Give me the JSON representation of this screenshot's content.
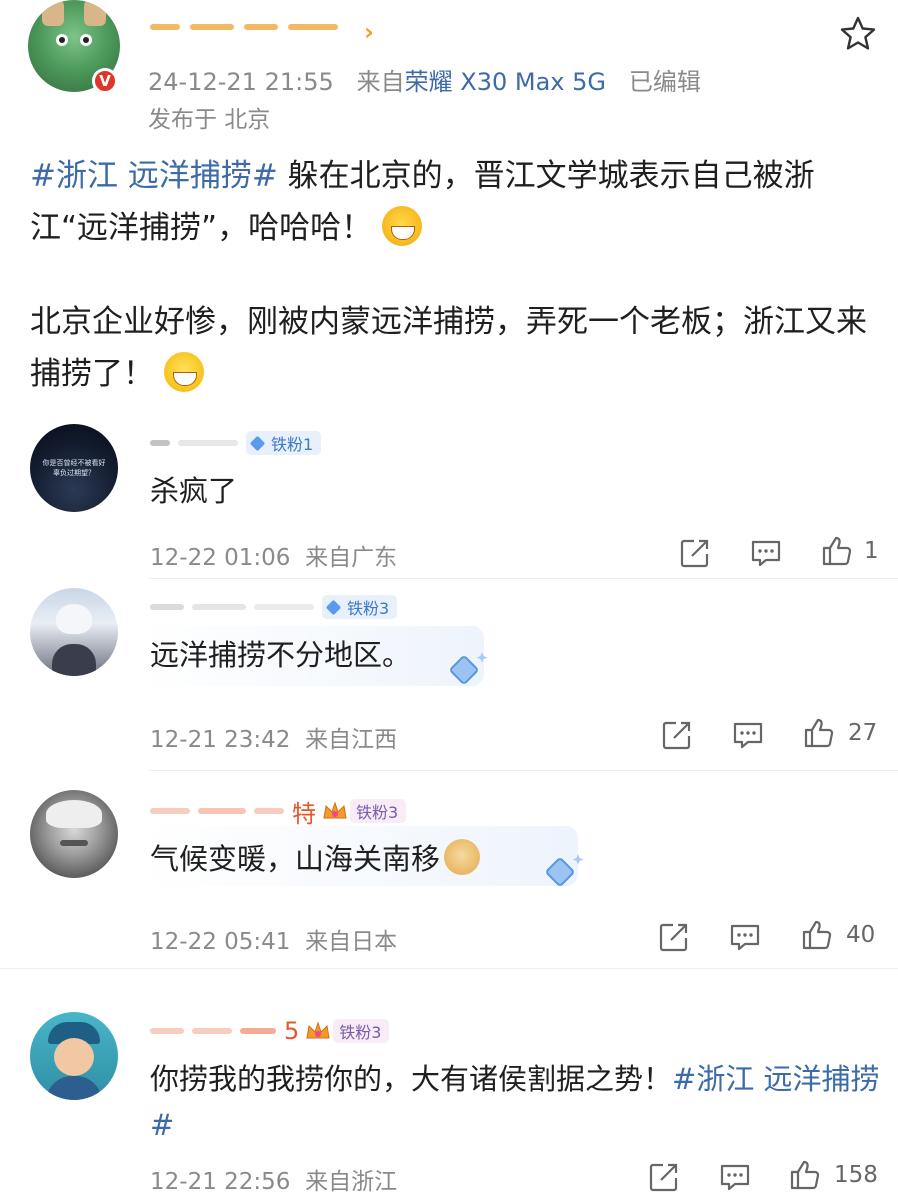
{
  "post": {
    "author_arrow": "›",
    "timestamp": "24-12-21 21:55",
    "source_prefix": "来自",
    "device": "荣耀 X30 Max 5G",
    "edited": "已编辑",
    "location": "发布于 北京",
    "verified_mark": "V",
    "paragraph1": {
      "topic": "#浙江 远洋捕捞#",
      "text": " 躲在北京的，晋江文学城表示自己被浙江“远洋捕捞”，哈哈哈！"
    },
    "paragraph2": {
      "text": "北京企业好惨，刚被内蒙远洋捕捞，弄死一个老板；浙江又来捕捞了！"
    }
  },
  "comments": [
    {
      "badge": "铁粉1",
      "text": "杀疯了",
      "time": "12-22 01:06",
      "source": "来自广东",
      "likes": "1",
      "avatar_caption": "你是否曾经不被看好 辜负过期望？"
    },
    {
      "badge": "铁粉3",
      "text": "远洋捕捞不分地区。",
      "time": "12-21 23:42",
      "source": "来自江西",
      "likes": "27"
    },
    {
      "name_visible": "特",
      "badge": "铁粉3",
      "text": "气候变暖，山海关南移",
      "time": "12-22 05:41",
      "source": "来自日本",
      "likes": "40"
    },
    {
      "name_visible": "5",
      "badge": "铁粉3",
      "text": "你捞我的我捞你的，大有诸侯割据之势！",
      "topic": "#浙江 远洋捕捞#",
      "time": "12-21 22:56",
      "source": "来自浙江",
      "likes": "158"
    }
  ],
  "colors": {
    "link": "#3d6aa8",
    "meta": "#8a8a8a",
    "badge_blue": "#3d78c9",
    "name_orange": "#e8572a"
  }
}
